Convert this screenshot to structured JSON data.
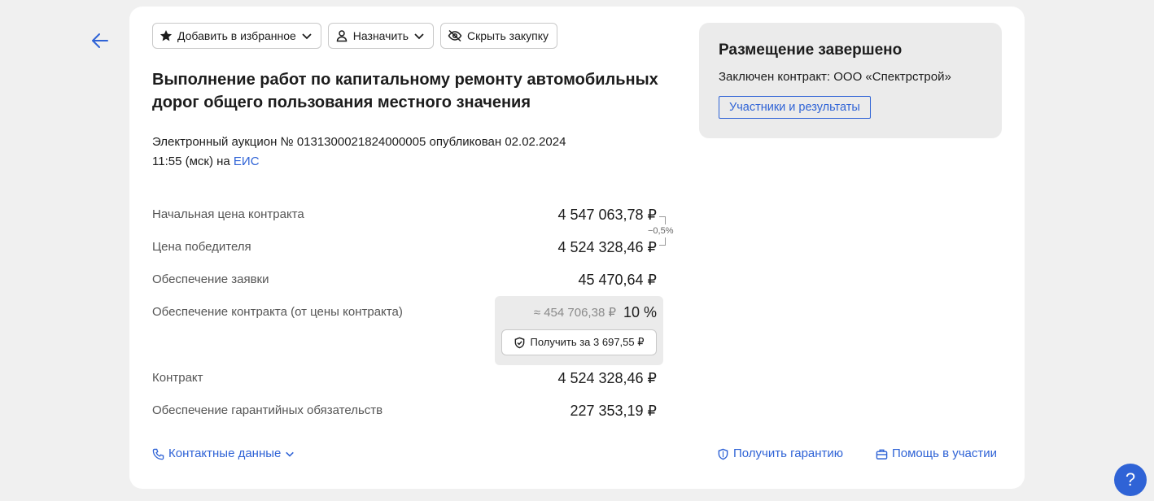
{
  "toolbar": {
    "favorite_label": "Добавить в избранное",
    "assign_label": "Назначить",
    "hide_label": "Скрыть закупку"
  },
  "tender": {
    "title": "Выполнение работ по капитальному ремонту автомобильных дорог общего пользования местного значения",
    "subtitle_text": "Электронный аукцион № 0131300021824000005 опубликован 02.02.2024 11:55 (мск) на ",
    "subtitle_link": "ЕИС"
  },
  "rows": {
    "initial_price": {
      "label": "Начальная цена контракта",
      "value": "4 547 063,78 ₽"
    },
    "winner_price": {
      "label": "Цена победителя",
      "value": "4 524 328,46 ₽"
    },
    "price_diff": "−0,5%",
    "bid_security": {
      "label": "Обеспечение заявки",
      "value": "45 470,64 ₽"
    },
    "contract_security": {
      "label": "Обеспечение контракта (от цены контракта)",
      "approx": "≈ 454 706,38 ₽",
      "percent": "10 %",
      "get_button": "Получить за 3 697,55 ₽"
    },
    "contract": {
      "label": "Контракт",
      "value": "4 524 328,46 ₽"
    },
    "warranty_security": {
      "label": "Обеспечение гарантийных обязательств",
      "value": "227 353,19 ₽"
    }
  },
  "footer": {
    "contacts": "Контактные данные",
    "get_guarantee": "Получить гарантию",
    "help_participation": "Помощь в участии"
  },
  "status": {
    "title": "Размещение завершено",
    "text": "Заключен контракт: ООО «Спектрстрой»",
    "button": "Участники и результаты"
  },
  "help_button": "?",
  "colors": {
    "accent": "#2f63d6",
    "panel": "#ebebeb",
    "background": "#f0f0f0"
  }
}
